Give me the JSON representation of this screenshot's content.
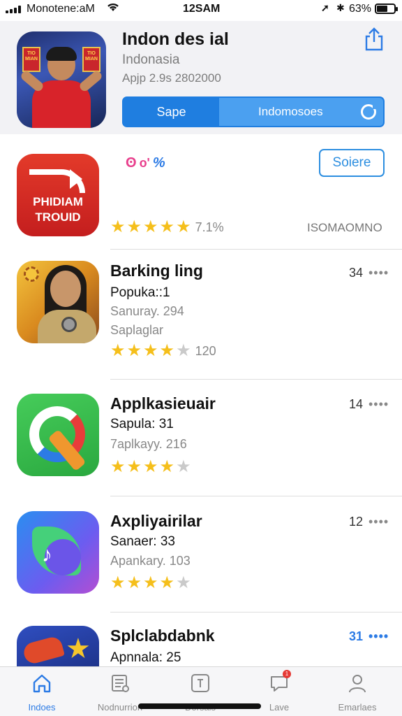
{
  "status_bar": {
    "carrier": "Monotene:aM",
    "time": "12SAM",
    "battery": "63%",
    "battery_level": 0.63
  },
  "featured": {
    "title": "Indon des ial",
    "subtitle": "Indonasia",
    "meta": "Apjp 2.9s 2802000",
    "segment_left": "Sape",
    "segment_right": "Indomosoes",
    "icon_sign_left": "TIO MIAN",
    "icon_sign_right": "TIO MIAN"
  },
  "apps": [
    {
      "icon_text": "PHIDIAM TROUID",
      "badge_a": "ʘ",
      "badge_b": "o'",
      "badge_c": "%",
      "button": "Soiere",
      "rating": 5,
      "rating_text": "7.1%",
      "developer": "ISOMAOMNO"
    },
    {
      "title": "Barking ling",
      "line2": "Popuka::1",
      "line3": "Sanuray. 294",
      "line4": "Saplaglar",
      "rank": "34",
      "rating": 4,
      "rating_count": "120"
    },
    {
      "title": "Applkasieuair",
      "line2": "Sapula: 31",
      "line3": "7aplkayy. 216",
      "rank": "14",
      "rating": 4,
      "rating_count": ""
    },
    {
      "title": "Axpliyairilar",
      "line2": "Sanaer: 33",
      "line3": "Apankary. 103",
      "rank": "12",
      "rating": 4,
      "rating_count": ""
    },
    {
      "title": "Splclabdabnk",
      "line2": "Apnnala: 25",
      "rank": "31"
    }
  ],
  "tabs": [
    {
      "label": "Indoes",
      "icon": "home-icon"
    },
    {
      "label": "Nodnurrion",
      "icon": "news-icon"
    },
    {
      "label": "Dorsals",
      "icon": "store-icon"
    },
    {
      "label": "Lave",
      "icon": "chat-icon",
      "badge": "1"
    },
    {
      "label": "Emarlaes",
      "icon": "profile-icon"
    }
  ],
  "more": "••••",
  "colors": {
    "accent": "#2c7be5",
    "star": "#f5bf1b",
    "segment": "#1f7ee0"
  }
}
